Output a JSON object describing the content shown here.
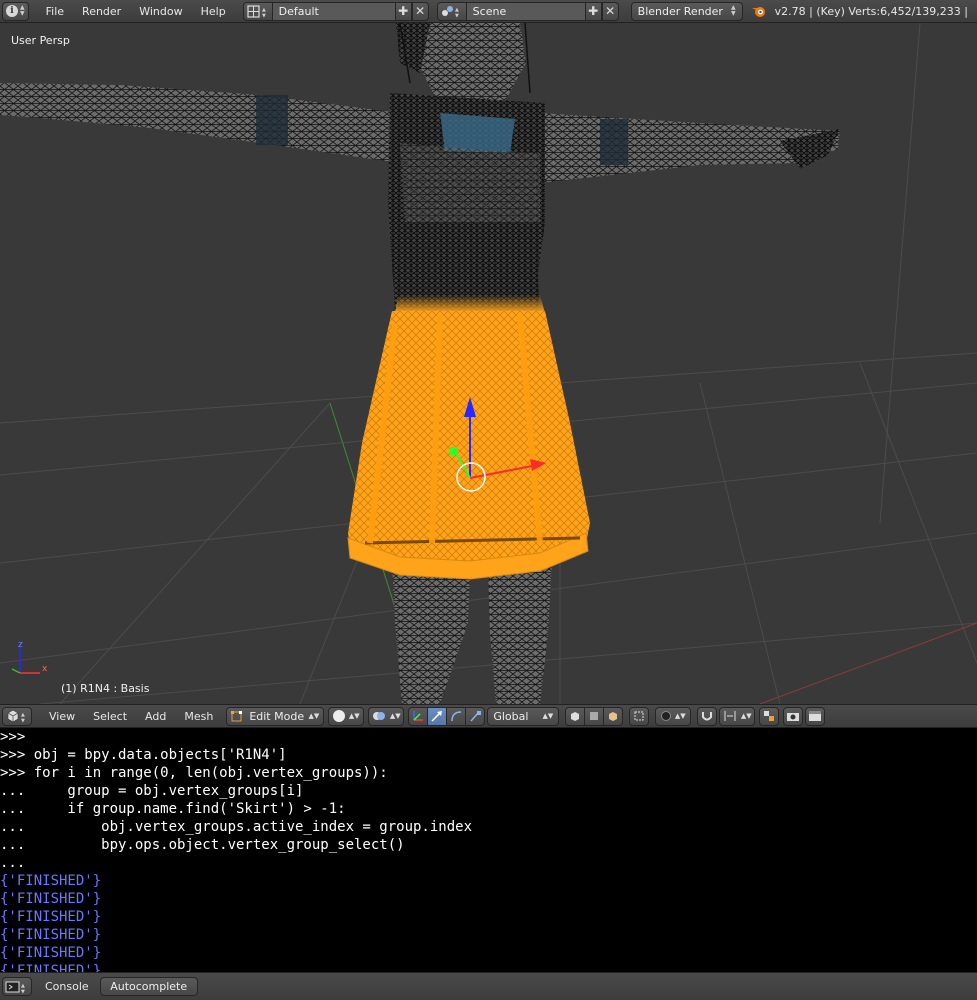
{
  "top_header": {
    "menus": [
      "File",
      "Render",
      "Window",
      "Help"
    ],
    "layout_name": "Default",
    "scene_name": "Scene",
    "render_engine": "Blender Render",
    "stats": "v2.78 | (Key) Verts:6,452/139,233 |"
  },
  "viewport": {
    "view_label": "User Persp",
    "object_label": "(1) R1N4 : Basis",
    "axis_x": "x",
    "axis_z": "z"
  },
  "view3d_header": {
    "menus": [
      "View",
      "Select",
      "Add",
      "Mesh"
    ],
    "mode": "Edit Mode",
    "orientation": "Global"
  },
  "console": {
    "lines": [
      {
        "text": ">>>",
        "kind": "code"
      },
      {
        "text": ">>> obj = bpy.data.objects['R1N4']",
        "kind": "code"
      },
      {
        "text": ">>> for i in range(0, len(obj.vertex_groups)):",
        "kind": "code"
      },
      {
        "text": "...     group = obj.vertex_groups[i]",
        "kind": "code"
      },
      {
        "text": "...     if group.name.find('Skirt') > -1:",
        "kind": "code"
      },
      {
        "text": "...         obj.vertex_groups.active_index = group.index",
        "kind": "code"
      },
      {
        "text": "...         bpy.ops.object.vertex_group_select()",
        "kind": "code"
      },
      {
        "text": "...",
        "kind": "code"
      },
      {
        "text": "{'FINISHED'}",
        "kind": "out"
      },
      {
        "text": "{'FINISHED'}",
        "kind": "out"
      },
      {
        "text": "{'FINISHED'}",
        "kind": "out"
      },
      {
        "text": "{'FINISHED'}",
        "kind": "out"
      },
      {
        "text": "{'FINISHED'}",
        "kind": "out"
      },
      {
        "text": "{'FINISHED'}",
        "kind": "out"
      }
    ]
  },
  "console_header": {
    "console_tab": "Console",
    "autocomplete_button": "Autocomplete"
  },
  "colors": {
    "selection": "#ffa31a",
    "wire": "#000000",
    "grid": "#4a4a4a",
    "console_output": "#6a78ff"
  }
}
